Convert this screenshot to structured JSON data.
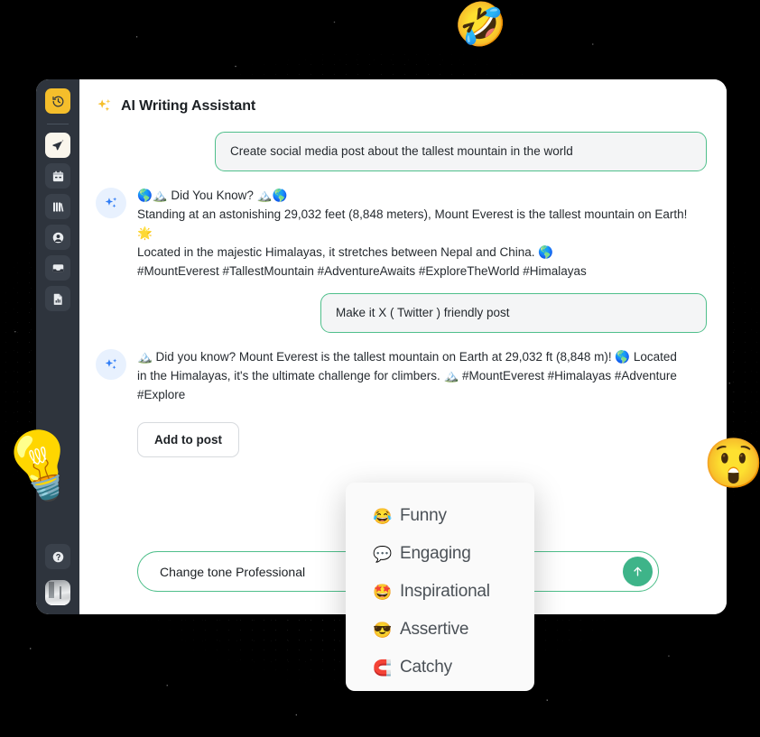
{
  "theme": {
    "background": "#000000",
    "sidebar_bg": "#2E343D",
    "card_bg": "#FFFFFF",
    "accent_green": "#4FBF8B",
    "send_green": "#3EB489",
    "accent_amber": "#F5BE2B",
    "ai_avatar_bg": "#E8F1FE",
    "ai_spark_blue": "#2F7DF6",
    "bubble_bg": "#F4F5F6",
    "menu_bg": "#FAFAFA"
  },
  "sidebar": {
    "items": [
      {
        "name": "history-clock",
        "icon": "clock-history-icon",
        "state": "active"
      },
      {
        "name": "send-compose",
        "icon": "paper-plane-icon",
        "state": "highlight"
      },
      {
        "name": "calendar",
        "icon": "calendar-icon",
        "state": "normal"
      },
      {
        "name": "library",
        "icon": "library-books-icon",
        "state": "normal"
      },
      {
        "name": "contacts",
        "icon": "user-circle-icon",
        "state": "normal"
      },
      {
        "name": "inbox",
        "icon": "inbox-tray-icon",
        "state": "normal"
      },
      {
        "name": "reports",
        "icon": "document-chart-icon",
        "state": "normal"
      }
    ],
    "footer": [
      {
        "name": "help",
        "icon": "question-mark-icon"
      },
      {
        "name": "profile",
        "icon": "avatar-photo"
      }
    ]
  },
  "header": {
    "title": "AI Writing Assistant",
    "icon": "sparkles-icon"
  },
  "thread": [
    {
      "role": "user",
      "text": "Create social media post about the tallest mountain in the world"
    },
    {
      "role": "assistant",
      "lines": [
        "🌎🏔️ Did You Know? 🏔️🌎",
        "Standing at an astonishing 29,032 feet (8,848 meters), Mount Everest is the tallest mountain on Earth! 🌟",
        "Located in the majestic Himalayas, it stretches between Nepal and China. 🌎",
        "#MountEverest #TallestMountain #AdventureAwaits #ExploreTheWorld #Himalayas"
      ]
    },
    {
      "role": "user",
      "text": "Make it X ( Twitter ) friendly post"
    },
    {
      "role": "assistant",
      "lines": [
        "🏔️ Did you know? Mount Everest is the tallest mountain on Earth at 29,032 ft (8,848 m)! 🌎 Located in the Himalayas, it's the ultimate challenge for climbers. 🏔️ #MountEverest #Himalayas #Adventure #Explore"
      ]
    }
  ],
  "actions": {
    "add_to_post_label": "Add to post"
  },
  "composer": {
    "value": "Change tone Professional",
    "placeholder": "Change tone Professional",
    "send_icon": "arrow-up-icon"
  },
  "tone_menu": {
    "items": [
      {
        "emoji": "😂",
        "label": "Funny",
        "icon": "face-with-tears-of-joy-icon"
      },
      {
        "emoji": "💬",
        "label": "Engaging",
        "icon": "speech-balloon-icon"
      },
      {
        "emoji": "🤩",
        "label": "Inspirational",
        "icon": "star-struck-icon"
      },
      {
        "emoji": "😎",
        "label": "Assertive",
        "icon": "smiling-face-with-sunglasses-icon"
      },
      {
        "emoji": "🧲",
        "label": "Catchy",
        "icon": "magnet-icon"
      }
    ]
  },
  "decorations": [
    {
      "emoji": "🤣",
      "name": "rolling-on-the-floor-laughing-emoji"
    },
    {
      "emoji": "💡",
      "name": "light-bulb-emoji"
    },
    {
      "emoji": "😲",
      "name": "astonished-face-emoji"
    }
  ]
}
